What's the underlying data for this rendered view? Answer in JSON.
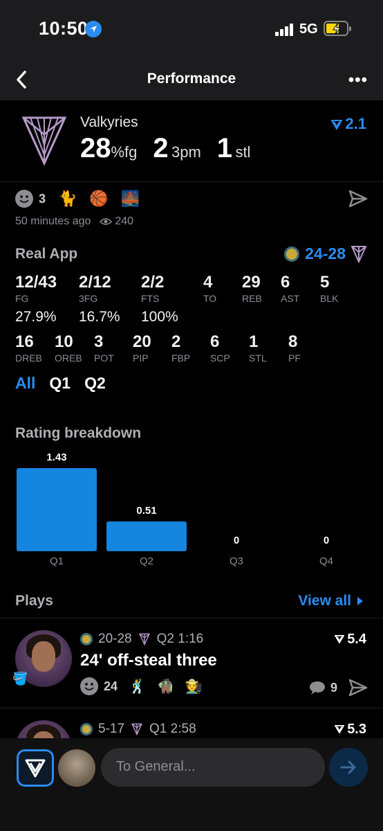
{
  "status": {
    "time": "10:50",
    "network": "5G"
  },
  "nav": {
    "title": "Performance"
  },
  "header": {
    "team": "Valkyries",
    "fg_pct": "28",
    "fg_unit": "%fg",
    "threes": "2",
    "threes_unit": "3pm",
    "steals": "1",
    "steals_unit": "stl",
    "rating": "2.1"
  },
  "reactions": {
    "count": "3",
    "emojis": [
      "🐈",
      "🏀",
      "🌉"
    ]
  },
  "meta": {
    "posted": "50 minutes ago",
    "views": "240"
  },
  "real_app": {
    "title": "Real App",
    "score": "24-28",
    "row1": [
      {
        "value": "12/43",
        "label": "FG"
      },
      {
        "value": "2/12",
        "label": "3FG"
      },
      {
        "value": "2/2",
        "label": "FTS"
      },
      {
        "value": "4",
        "label": "TO"
      },
      {
        "value": "29",
        "label": "REB"
      },
      {
        "value": "6",
        "label": "AST"
      },
      {
        "value": "5",
        "label": "BLK"
      }
    ],
    "pcts": [
      "27.9%",
      "16.7%",
      "100%"
    ],
    "row2": [
      {
        "value": "16",
        "label": "DREB"
      },
      {
        "value": "10",
        "label": "OREB"
      },
      {
        "value": "3",
        "label": "POT"
      },
      {
        "value": "20",
        "label": "PIP"
      },
      {
        "value": "2",
        "label": "FBP"
      },
      {
        "value": "6",
        "label": "SCP"
      },
      {
        "value": "1",
        "label": "STL"
      },
      {
        "value": "8",
        "label": "PF"
      }
    ],
    "tabs": [
      "All",
      "Q1",
      "Q2"
    ],
    "active_tab": "All"
  },
  "rating_breakdown": {
    "title": "Rating breakdown"
  },
  "chart_data": {
    "type": "bar",
    "categories": [
      "Q1",
      "Q2",
      "Q3",
      "Q4"
    ],
    "values": [
      1.43,
      0.51,
      0,
      0
    ],
    "value_labels": [
      "1.43",
      "0.51",
      "0",
      "0"
    ],
    "title": "Rating breakdown",
    "ylim": [
      0,
      1.43
    ],
    "grid": false
  },
  "plays": {
    "title": "Plays",
    "view_all": "View all",
    "items": [
      {
        "score": "20-28",
        "clock": "Q2 1:16",
        "rating": "5.4",
        "title": "24' off-steal three",
        "reactions": "24",
        "emojis": [
          "🕺",
          "🧌",
          "🧑‍🌾"
        ],
        "comments": "9"
      },
      {
        "score": "5-17",
        "clock": "Q1 2:58",
        "rating": "5.3"
      }
    ]
  },
  "composer": {
    "placeholder": "To General..."
  },
  "colors": {
    "accent": "#2a8cf0",
    "bar": "#1585e0",
    "background": "#000000"
  }
}
